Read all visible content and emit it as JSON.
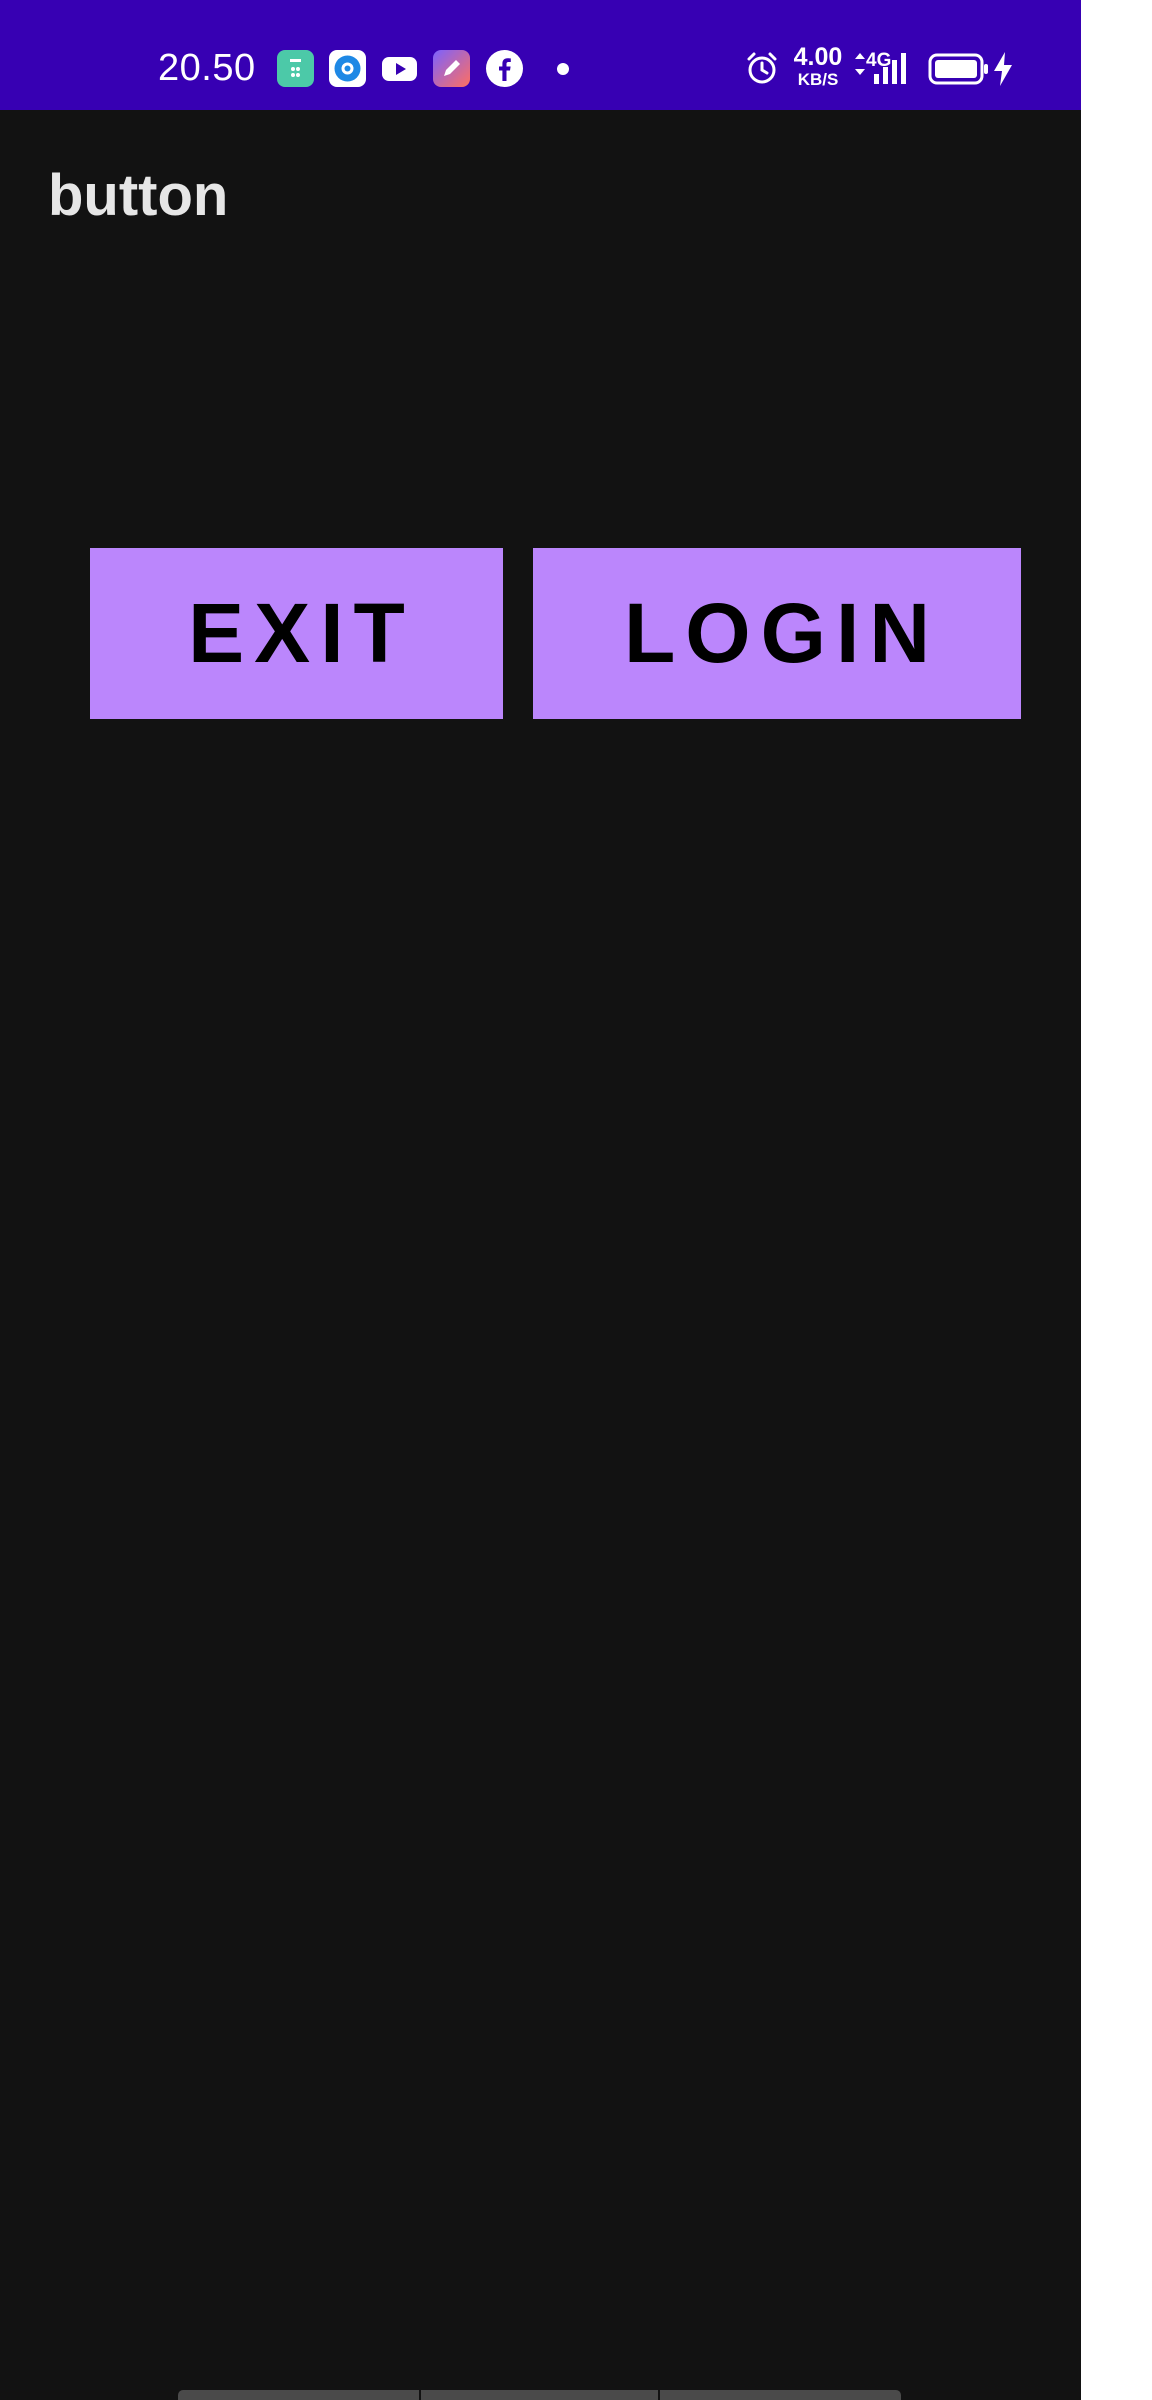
{
  "status_bar": {
    "time": "20.50",
    "network_speed_value": "4.00",
    "network_speed_unit": "KB/S",
    "network_type": "4G",
    "background_color": "#3700b3",
    "notification_icons": [
      "cleaner-app-icon",
      "browser-app-icon",
      "youtube-icon",
      "editor-app-icon",
      "facebook-icon",
      "more-notifications-dot-icon"
    ],
    "system_icons": [
      "alarm-icon",
      "network-speed",
      "4g-signal-icon",
      "signal-bars-icon",
      "battery-icon",
      "charging-bolt-icon"
    ]
  },
  "app": {
    "title": "button",
    "background_color": "#121212",
    "accent_color": "#bb86fc"
  },
  "buttons": {
    "exit_label": "EXIT",
    "login_label": "LOGIN"
  }
}
